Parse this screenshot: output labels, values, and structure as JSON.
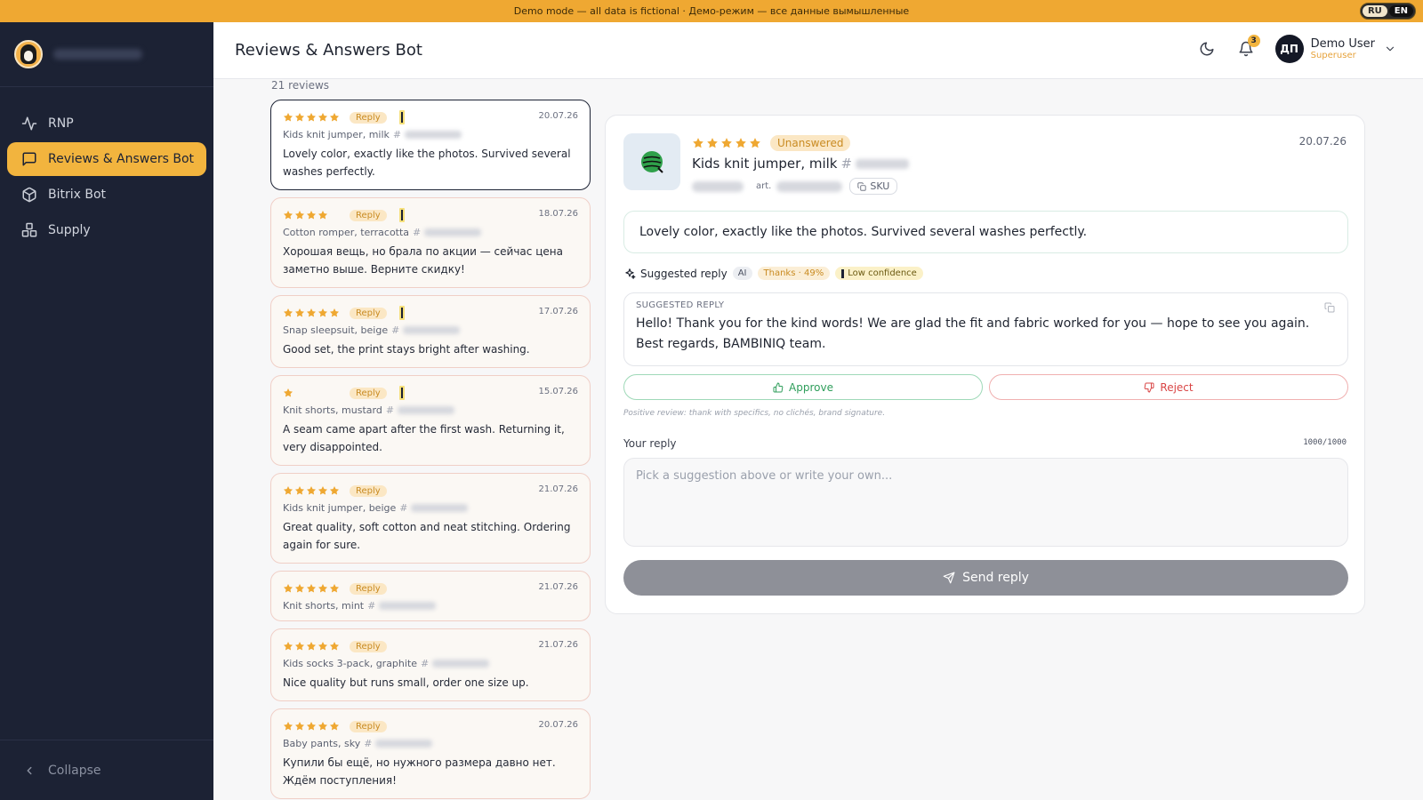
{
  "banner": {
    "text": "Demo mode — all data is fictional · Демо-режим — все данные вымышленные",
    "lang_ru": "RU",
    "lang_en": "EN"
  },
  "sidebar": {
    "items": [
      {
        "label": "RNP",
        "icon": "activity-icon"
      },
      {
        "label": "Reviews & Answers Bot",
        "icon": "message-square-icon",
        "active": true
      },
      {
        "label": "Bitrix Bot",
        "icon": "box-icon"
      },
      {
        "label": "Supply",
        "icon": "boxes-icon"
      }
    ],
    "collapse_label": "Collapse"
  },
  "header": {
    "title": "Reviews & Answers Bot",
    "notifications_count": "3",
    "user": {
      "initials": "ДП",
      "name": "Demo User",
      "role": "Superuser"
    }
  },
  "list": {
    "count_label": "21 reviews",
    "reply_label": "Reply",
    "reviews": [
      {
        "rating": 5,
        "date": "20.07.26",
        "product": "Kids knit jumper, milk",
        "text": "Lovely color, exactly like the photos. Survived several washes perfectly.",
        "low_conf": true,
        "selected": true
      },
      {
        "rating": 4,
        "date": "18.07.26",
        "product": "Cotton romper, terracotta",
        "text": "Хорошая вещь, но брала по акции — сейчас цена заметно выше. Верните скидку!",
        "low_conf": true
      },
      {
        "rating": 5,
        "date": "17.07.26",
        "product": "Snap sleepsuit, beige",
        "text": "Good set, the print stays bright after washing.",
        "low_conf": true
      },
      {
        "rating": 1,
        "date": "15.07.26",
        "product": "Knit shorts, mustard",
        "text": "A seam came apart after the first wash. Returning it, very disappointed.",
        "low_conf": true
      },
      {
        "rating": 5,
        "date": "21.07.26",
        "product": "Kids knit jumper, beige",
        "text": "Great quality, soft cotton and neat stitching. Ordering again for sure.",
        "low_conf": false
      },
      {
        "rating": 5,
        "date": "21.07.26",
        "product": "Knit shorts, mint",
        "text": "",
        "low_conf": false
      },
      {
        "rating": 5,
        "date": "21.07.26",
        "product": "Kids socks 3-pack, graphite",
        "text": "Nice quality but runs small, order one size up.",
        "low_conf": false
      },
      {
        "rating": 5,
        "date": "20.07.26",
        "product": "Baby pants, sky",
        "text": "Купили бы ещё, но нужного размера давно нет. Ждём поступления!",
        "low_conf": false
      }
    ]
  },
  "detail": {
    "status": "Unanswered",
    "date": "20.07.26",
    "product_name": "Kids knit jumper, milk",
    "art_label": "art.",
    "sku_label": "SKU",
    "review_text": "Lovely color, exactly like the photos. Survived several washes perfectly.",
    "suggested_title": "Suggested reply",
    "ai_label": "AI",
    "thanks_label": "Thanks · 49%",
    "low_conf_label": "Low confidence",
    "suggested_label": "SUGGESTED REPLY",
    "suggested_text": "Hello! Thank you for the kind words! We are glad the fit and fabric worked for you — hope to see you again. Best regards, BAMBINIQ team.",
    "approve_label": "Approve",
    "reject_label": "Reject",
    "hint": "Positive review: thank with specifics, no clichés, brand signature.",
    "your_reply_label": "Your reply",
    "char_count": "1000/1000",
    "reply_placeholder": "Pick a suggestion above or write your own...",
    "send_label": "Send reply"
  },
  "colors": {
    "accent": "#f2b43e",
    "sidebar_bg": "#1c2234",
    "star": "#efa832",
    "approve": "#2f9e5b",
    "reject": "#d94545"
  }
}
